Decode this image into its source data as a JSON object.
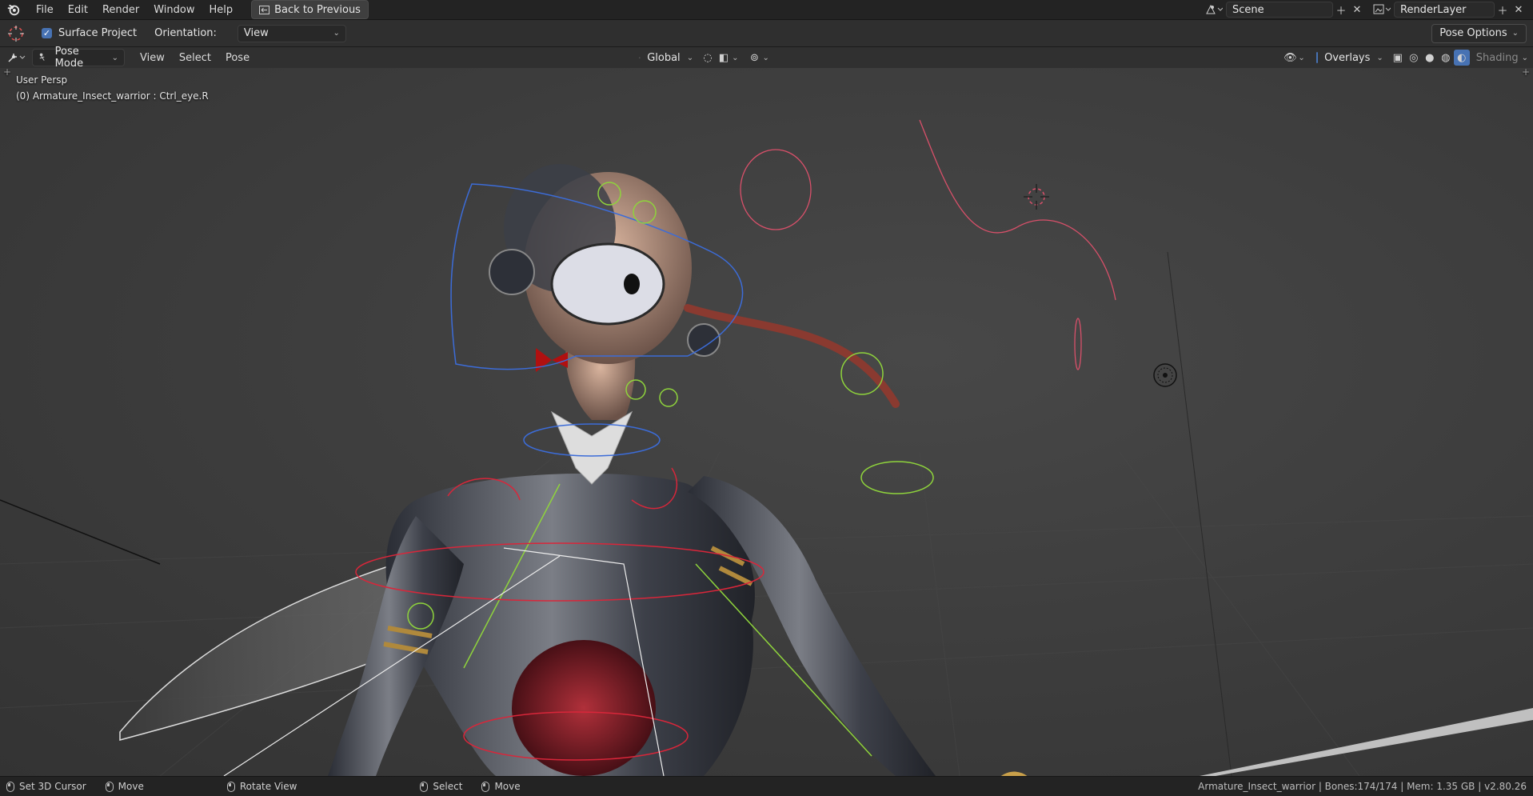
{
  "topbar": {
    "menus": [
      "File",
      "Edit",
      "Render",
      "Window",
      "Help"
    ],
    "back_button": "Back to Previous",
    "scene": "Scene",
    "render_layer": "RenderLayer"
  },
  "toolbar": {
    "surface_project": "Surface Project",
    "orientation_label": "Orientation:",
    "orientation_value": "View",
    "pose_options": "Pose Options"
  },
  "header3d": {
    "mode": "Pose Mode",
    "menus": [
      "View",
      "Select",
      "Pose"
    ],
    "transform_orientation": "Global",
    "overlays": "Overlays",
    "shading": "Shading"
  },
  "viewport": {
    "view_name": "User Persp",
    "active_object": "(0) Armature_Insect_warrior : Ctrl_eye.R"
  },
  "statusbar": {
    "items": [
      "Set 3D Cursor",
      "Move",
      "Rotate View",
      "Select",
      "Move"
    ],
    "info": "Armature_Insect_warrior | Bones:174/174 | Mem: 1.35 GB | v2.80.26"
  },
  "colors": {
    "accent": "#4772b3",
    "bone_red": "#d9263a",
    "bone_green": "#8fd43c",
    "bone_blue": "#3c6cd8"
  }
}
